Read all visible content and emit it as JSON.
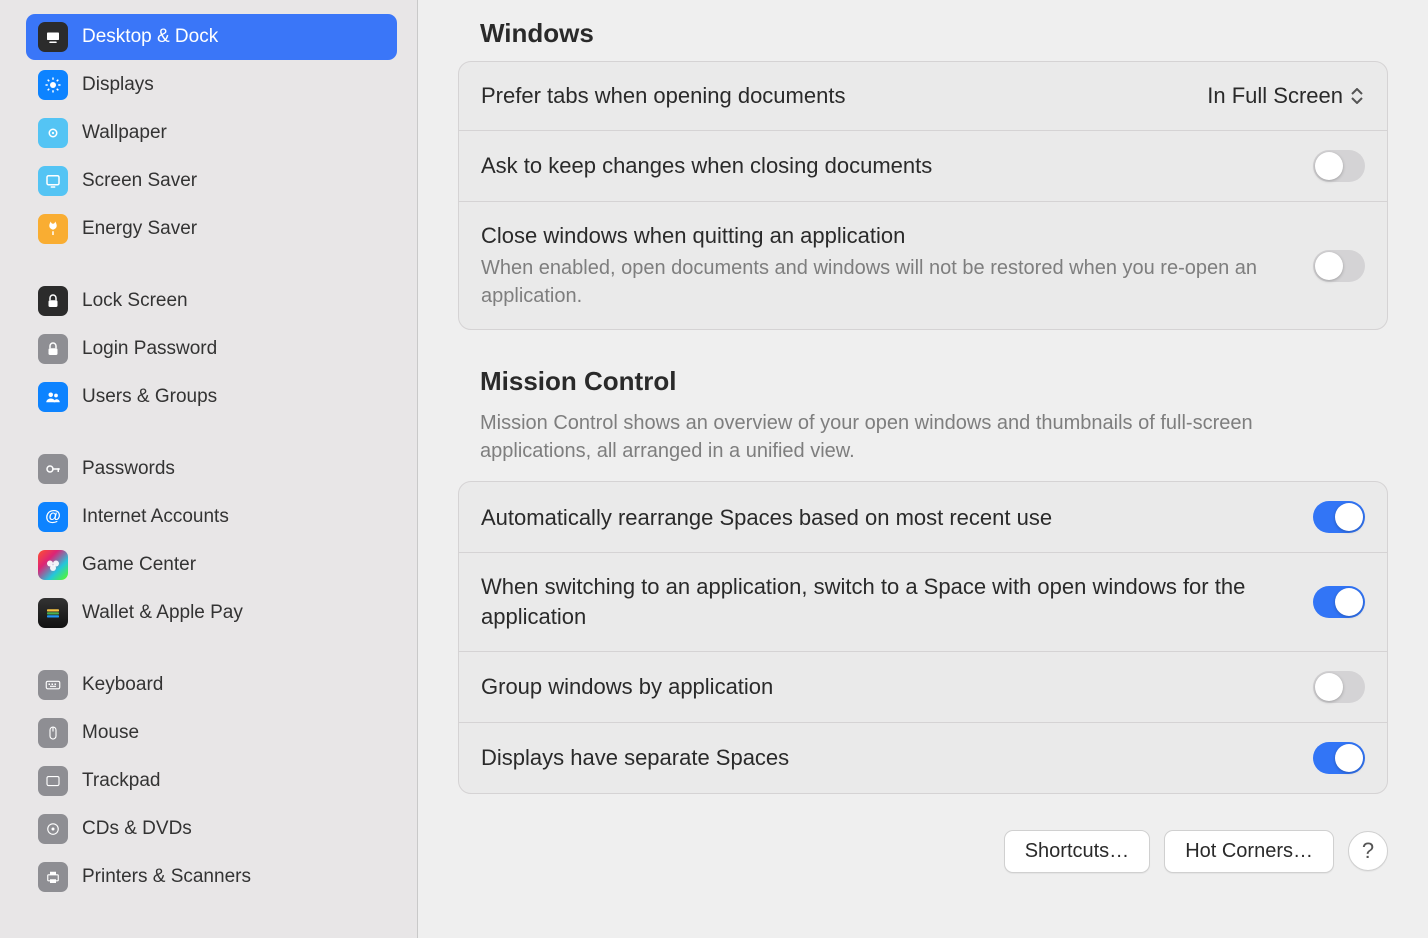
{
  "sidebar": {
    "items": [
      {
        "label": "Desktop & Dock",
        "selected": true
      },
      {
        "label": "Displays"
      },
      {
        "label": "Wallpaper"
      },
      {
        "label": "Screen Saver"
      },
      {
        "label": "Energy Saver"
      },
      {
        "label": "Lock Screen"
      },
      {
        "label": "Login Password"
      },
      {
        "label": "Users & Groups"
      },
      {
        "label": "Passwords"
      },
      {
        "label": "Internet Accounts"
      },
      {
        "label": "Game Center"
      },
      {
        "label": "Wallet & Apple Pay"
      },
      {
        "label": "Keyboard"
      },
      {
        "label": "Mouse"
      },
      {
        "label": "Trackpad"
      },
      {
        "label": "CDs & DVDs"
      },
      {
        "label": "Printers & Scanners"
      }
    ]
  },
  "sections": {
    "windows": {
      "title": "Windows",
      "rows": {
        "prefer_tabs": {
          "label": "Prefer tabs when opening documents",
          "value": "In Full Screen"
        },
        "ask_keep": {
          "label": "Ask to keep changes when closing documents",
          "on": false
        },
        "close_quit": {
          "label": "Close windows when quitting an application",
          "desc": "When enabled, open documents and windows will not be restored when you re-open an application.",
          "on": false
        }
      }
    },
    "mission_control": {
      "title": "Mission Control",
      "desc": "Mission Control shows an overview of your open windows and thumbnails of full-screen applications, all arranged in a unified view.",
      "rows": {
        "rearrange": {
          "label": "Automatically rearrange Spaces based on most recent use",
          "on": true
        },
        "switch_space": {
          "label": "When switching to an application, switch to a Space with open windows for the application",
          "on": true
        },
        "group_app": {
          "label": "Group windows by application",
          "on": false
        },
        "separate_spaces": {
          "label": "Displays have separate Spaces",
          "on": true
        }
      }
    }
  },
  "footer": {
    "shortcuts": "Shortcuts…",
    "hot_corners": "Hot Corners…",
    "help": "?"
  }
}
